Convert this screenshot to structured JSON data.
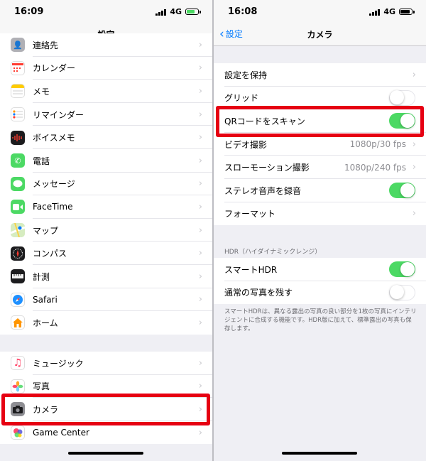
{
  "left": {
    "status": {
      "time": "16:09",
      "network": "4G"
    },
    "nav_title": "設定",
    "group1": [
      {
        "label": "連絡先",
        "icon": "contacts-icon"
      },
      {
        "label": "カレンダー",
        "icon": "calendar-icon"
      },
      {
        "label": "メモ",
        "icon": "notes-icon"
      },
      {
        "label": "リマインダー",
        "icon": "reminders-icon"
      },
      {
        "label": "ボイスメモ",
        "icon": "voice-memos-icon"
      },
      {
        "label": "電話",
        "icon": "phone-icon"
      },
      {
        "label": "メッセージ",
        "icon": "messages-icon"
      },
      {
        "label": "FaceTime",
        "icon": "facetime-icon"
      },
      {
        "label": "マップ",
        "icon": "maps-icon"
      },
      {
        "label": "コンパス",
        "icon": "compass-icon"
      },
      {
        "label": "計測",
        "icon": "measure-icon"
      },
      {
        "label": "Safari",
        "icon": "safari-icon"
      },
      {
        "label": "ホーム",
        "icon": "home-icon"
      }
    ],
    "group2": [
      {
        "label": "ミュージック",
        "icon": "music-icon"
      },
      {
        "label": "写真",
        "icon": "photos-icon"
      },
      {
        "label": "カメラ",
        "icon": "camera-icon"
      },
      {
        "label": "Game Center",
        "icon": "game-center-icon"
      }
    ]
  },
  "right": {
    "status": {
      "time": "16:08",
      "network": "4G"
    },
    "back_label": "設定",
    "nav_title": "カメラ",
    "group1": [
      {
        "label": "設定を保持",
        "type": "chevron"
      },
      {
        "label": "グリッド",
        "type": "toggle",
        "on": false
      },
      {
        "label": "QRコードをスキャン",
        "type": "toggle",
        "on": true
      },
      {
        "label": "ビデオ撮影",
        "type": "value",
        "value": "1080p/30 fps"
      },
      {
        "label": "スローモーション撮影",
        "type": "value",
        "value": "1080p/240 fps"
      },
      {
        "label": "ステレオ音声を録音",
        "type": "toggle",
        "on": true
      },
      {
        "label": "フォーマット",
        "type": "chevron"
      }
    ],
    "hdr_header": "HDR（ハイダイナミックレンジ）",
    "group2": [
      {
        "label": "スマートHDR",
        "type": "toggle",
        "on": true
      },
      {
        "label": "通常の写真を残す",
        "type": "toggle",
        "on": false
      }
    ],
    "hdr_footer": "スマートHDRは、異なる露出の写真の良い部分を1枚の写真にインテリジェントに合成する機能です。HDR版に加えて、標準露出の写真も保存します。"
  },
  "colors": {
    "accent": "#007aff",
    "toggle_on": "#4cd964",
    "highlight": "#e60012",
    "battery_charging": "#4cd964"
  }
}
